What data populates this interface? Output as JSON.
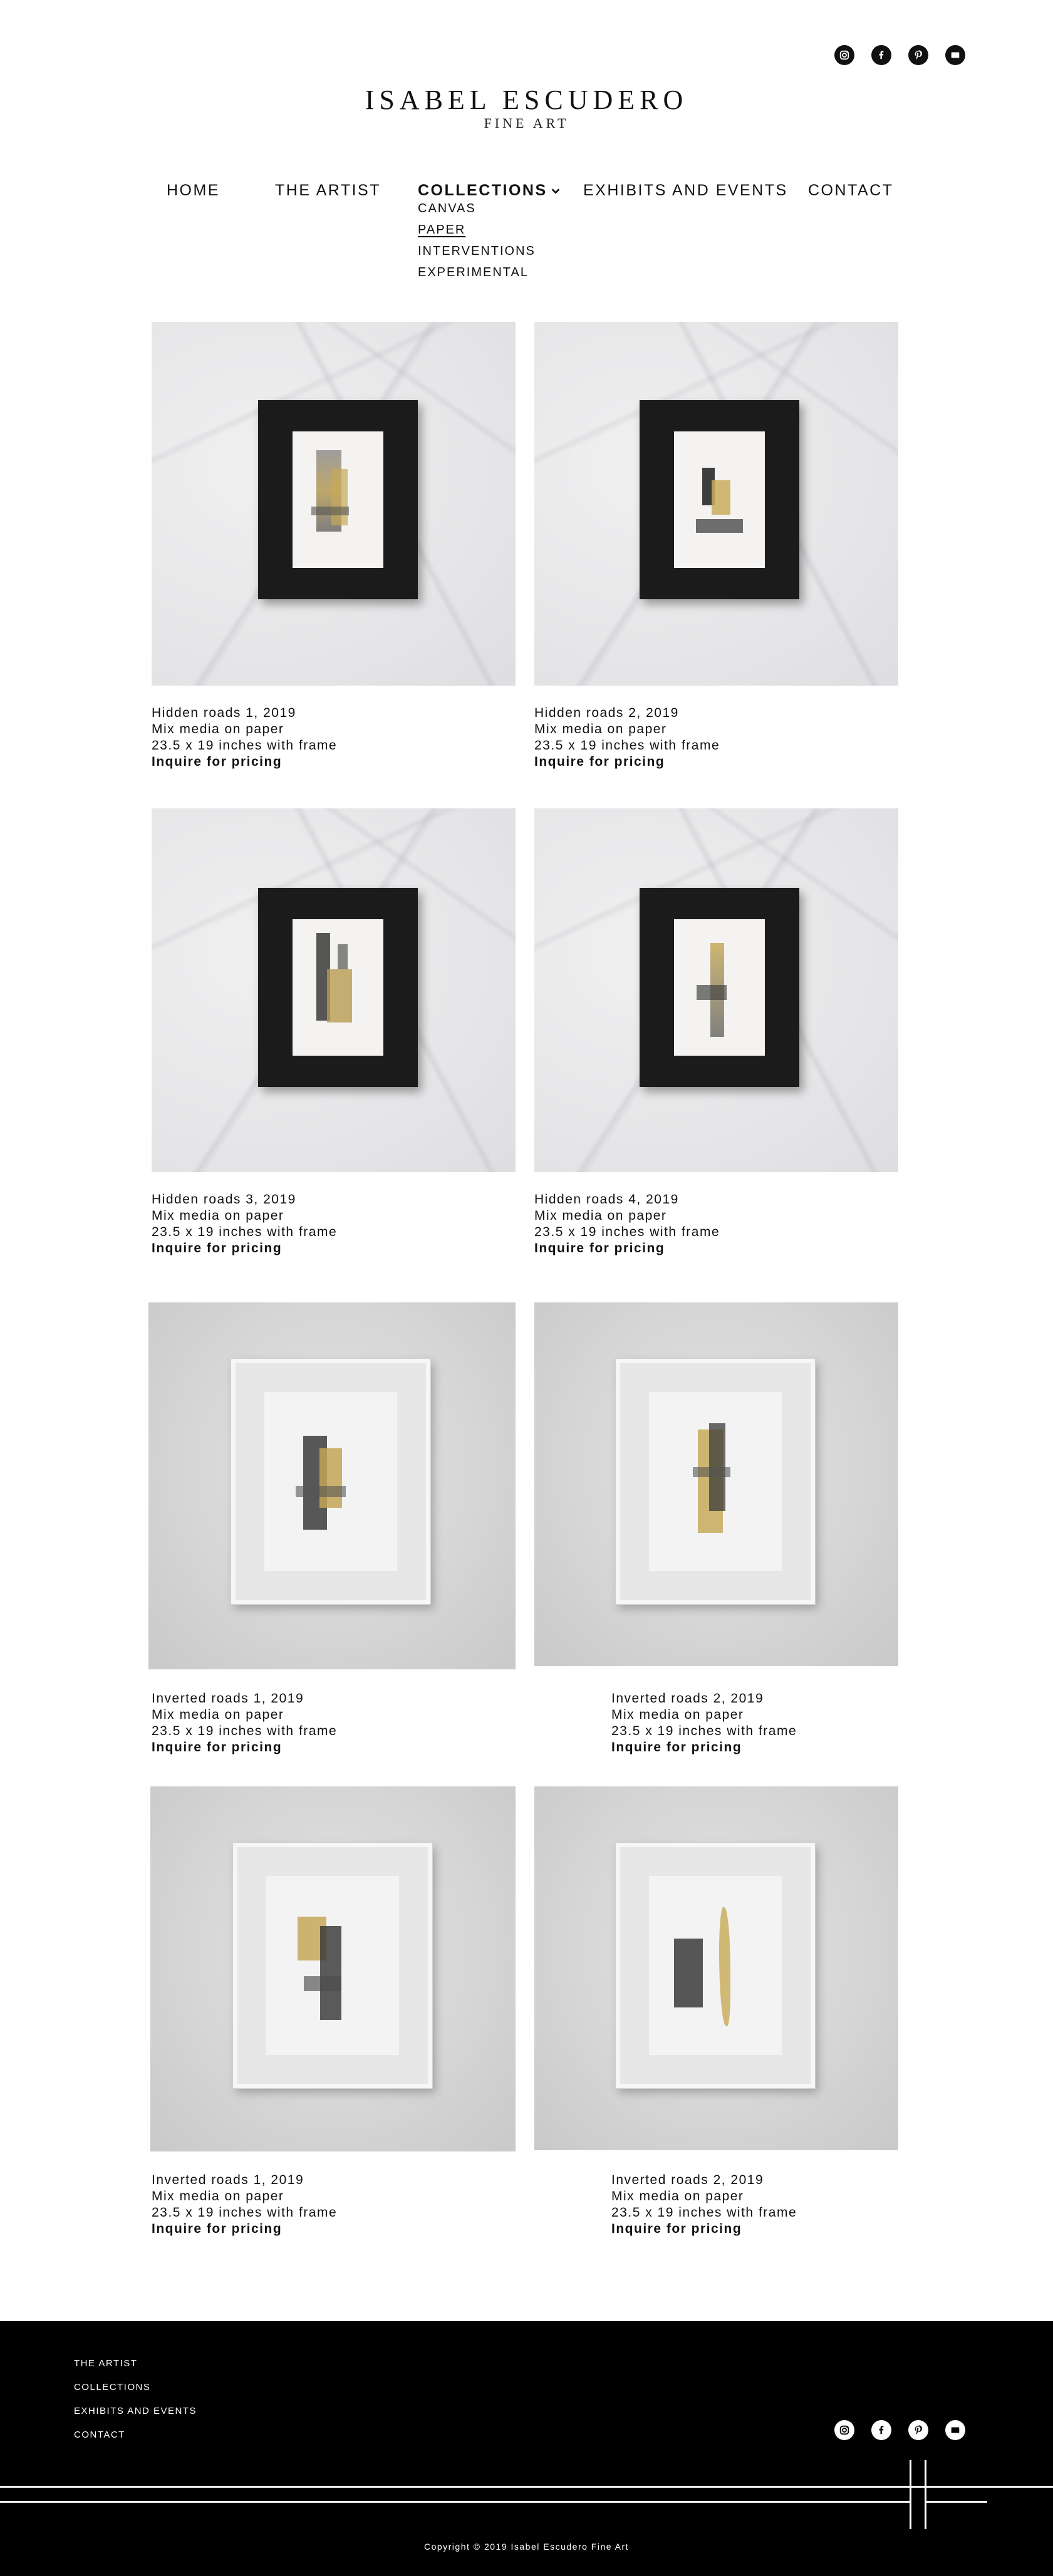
{
  "brand": {
    "title": "ISABEL ESCUDERO",
    "subtitle": "FINE ART"
  },
  "social": [
    "instagram-icon",
    "facebook-icon",
    "pinterest-icon",
    "email-icon"
  ],
  "nav": {
    "home": "HOME",
    "artist": "THE ARTIST",
    "collections": "COLLECTIONS",
    "exhibits": "EXHIBITS AND EVENTS",
    "contact": "CONTACT"
  },
  "submenu": [
    "CANVAS",
    "PAPER",
    "INTERVENTIONS",
    "EXPERIMENTAL"
  ],
  "artworks": [
    {
      "title": "Hidden roads 1, 2019",
      "medium": "Mix media on paper",
      "size": "23.5 x 19 inches with frame",
      "cta": "Inquire for pricing"
    },
    {
      "title": "Hidden roads 2, 2019",
      "medium": "Mix media on paper",
      "size": "23.5 x 19 inches with frame",
      "cta": "Inquire for pricing"
    },
    {
      "title": "Hidden roads 3, 2019",
      "medium": "Mix media on paper",
      "size": "23.5 x 19 inches with frame",
      "cta": "Inquire for pricing"
    },
    {
      "title": "Hidden roads 4, 2019",
      "medium": "Mix media on paper",
      "size": "23.5 x 19 inches with frame",
      "cta": "Inquire for pricing"
    },
    {
      "title": "Inverted roads 1, 2019",
      "medium": "Mix media on paper",
      "size": "23.5 x 19 inches with frame",
      "cta": "Inquire for pricing"
    },
    {
      "title": "Inverted roads 2, 2019",
      "medium": "Mix media on paper",
      "size": "23.5 x 19 inches with frame",
      "cta": "Inquire for pricing"
    },
    {
      "title": "Inverted roads 1, 2019",
      "medium": "Mix media on paper",
      "size": "23.5 x 19 inches with frame",
      "cta": "Inquire for pricing"
    },
    {
      "title": "Inverted roads 2, 2019",
      "medium": "Mix media on paper",
      "size": "23.5 x 19 inches with frame",
      "cta": "Inquire for pricing"
    }
  ],
  "footer": {
    "links": [
      "THE ARTIST",
      "COLLECTIONS",
      "EXHIBITS AND EVENTS",
      "CONTACT"
    ],
    "copyright": "Copyright © 2019 Isabel Escudero Fine Art"
  }
}
